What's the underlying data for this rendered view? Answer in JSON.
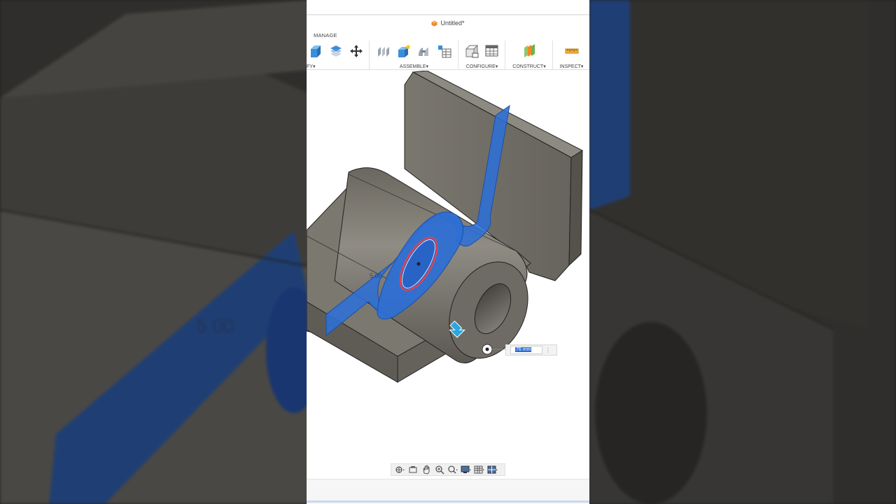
{
  "window": {
    "title": "Untitled*"
  },
  "ribbon": {
    "active_tab": "MANAGE",
    "groups": [
      {
        "id": "modify",
        "label": "FY",
        "icons": [
          "box-icon",
          "layers-icon",
          "move-icon"
        ]
      },
      {
        "id": "assemble",
        "label": "ASSEMBLE",
        "icons": [
          "joint-icon",
          "new-component-icon",
          "rigid-group-icon",
          "parameter-table-icon"
        ]
      },
      {
        "id": "configure",
        "label": "CONFIGURE",
        "icons": [
          "configure-part-icon",
          "configure-table-icon"
        ]
      },
      {
        "id": "construct",
        "label": "CONSTRUCT",
        "icons": [
          "offset-plane-icon"
        ]
      },
      {
        "id": "inspect",
        "label": "INSPECT",
        "icons": [
          "measure-icon"
        ]
      }
    ],
    "dropdown_glyph": "▾"
  },
  "viewport": {
    "dimension_label": "5.00",
    "input": {
      "value": "76 mm",
      "menu_glyph": "⋮"
    }
  },
  "navigation_bar": {
    "tools": [
      "orbit-icon",
      "look-at-icon",
      "pan-icon",
      "zoom-icon",
      "fit-icon",
      "display-settings-icon",
      "grid-settings-icon",
      "viewports-icon"
    ]
  },
  "colors": {
    "body": "#7d7a72",
    "body_dark": "#5f5c56",
    "body_top": "#8b8880",
    "plane": "#2d6fd6",
    "profile": "#e0434f",
    "accent": "#f08a24"
  },
  "background": {
    "dimension_label": "5.00"
  }
}
